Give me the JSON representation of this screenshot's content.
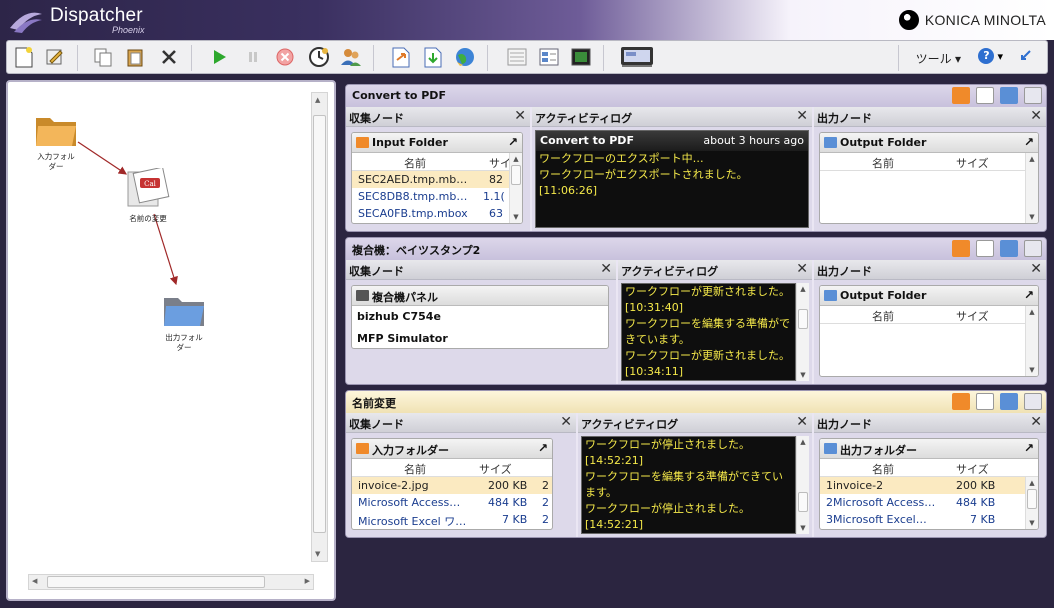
{
  "app": {
    "name": "Dispatcher",
    "edition": "Phoenix",
    "brand": "KONICA MINOLTA"
  },
  "toolbar": {
    "tool_menu": "ツール ▾",
    "help_menu": "?",
    "help_caret": "▾"
  },
  "canvas": {
    "nodes": [
      {
        "label": "入力フォル\nダー"
      },
      {
        "label": "名前の変更"
      },
      {
        "label": "出力フォル\nダー"
      }
    ]
  },
  "workflows": [
    {
      "title": "Convert to PDF",
      "collect": {
        "header": "収集ノード",
        "node_title": "Input Folder",
        "col_name": "名前",
        "col_size": "サイ",
        "rows": [
          {
            "name": "SEC2AED.tmp.mb…",
            "size": "82",
            "selected": true
          },
          {
            "name": "SEC8DB8.tmp.mb…",
            "size": "1.1("
          },
          {
            "name": "SECA0FB.tmp.mbox",
            "size": "63"
          }
        ]
      },
      "log": {
        "header": "アクティビティログ",
        "log_title": "Convert to PDF",
        "log_time": "about 3 hours ago",
        "lines": [
          "ワークフローのエクスポート中…",
          "ワークフローがエクスポートされました。",
          "[11:06:26]"
        ]
      },
      "output": {
        "header": "出力ノード",
        "node_title": "Output Folder",
        "col_name": "名前",
        "col_size": "サイズ",
        "rows": []
      }
    },
    {
      "title": "複合機：ベイツスタンプ2",
      "collect": {
        "header": "収集ノード",
        "node_title": "複合機パネル",
        "items": [
          "bizhub C754e",
          "MFP Simulator"
        ]
      },
      "log": {
        "header": "アクティビティログ",
        "lines": [
          "ワークフローが更新されました。",
          "[10:31:40]",
          "ワークフローを編集する準備がで",
          "きています。",
          "ワークフローが更新されました。",
          "[10:34:11]"
        ]
      },
      "output": {
        "header": "出力ノード",
        "node_title": "Output Folder",
        "col_name": "名前",
        "col_size": "サイズ",
        "rows": []
      }
    },
    {
      "title": "名前変更",
      "collect": {
        "header": "収集ノード",
        "node_title": "入力フォルダー",
        "col_name": "名前",
        "col_size": "サイズ",
        "rows": [
          {
            "name": "invoice-2.jpg",
            "size": "200 KB",
            "extra": "2",
            "selected": true
          },
          {
            "name": "Microsoft Access…",
            "size": "484 KB",
            "extra": "2"
          },
          {
            "name": "Microsoft Excel ワ…",
            "size": "7 KB",
            "extra": "2"
          }
        ]
      },
      "log": {
        "header": "アクティビティログ",
        "lines": [
          "ワークフローが停止されました。",
          "[14:52:21]",
          "ワークフローを編集する準備ができてい",
          "ます。",
          "ワークフローが停止されました。",
          "[14:52:21]"
        ]
      },
      "output": {
        "header": "出力ノード",
        "node_title": "出力フォルダー",
        "col_name": "名前",
        "col_size": "サイズ",
        "rows": [
          {
            "name": "1invoice-2",
            "size": "200 KB",
            "selected": true
          },
          {
            "name": "2Microsoft Access…",
            "size": "484 KB"
          },
          {
            "name": "3Microsoft Excel…",
            "size": "7 KB"
          }
        ]
      }
    }
  ],
  "colors": {
    "header_purple": "#2d2548",
    "folder_orange": "#f0a040",
    "folder_blue": "#5a8fd6",
    "log_text": "#f5e94a",
    "selected_row": "#fbeac1"
  }
}
